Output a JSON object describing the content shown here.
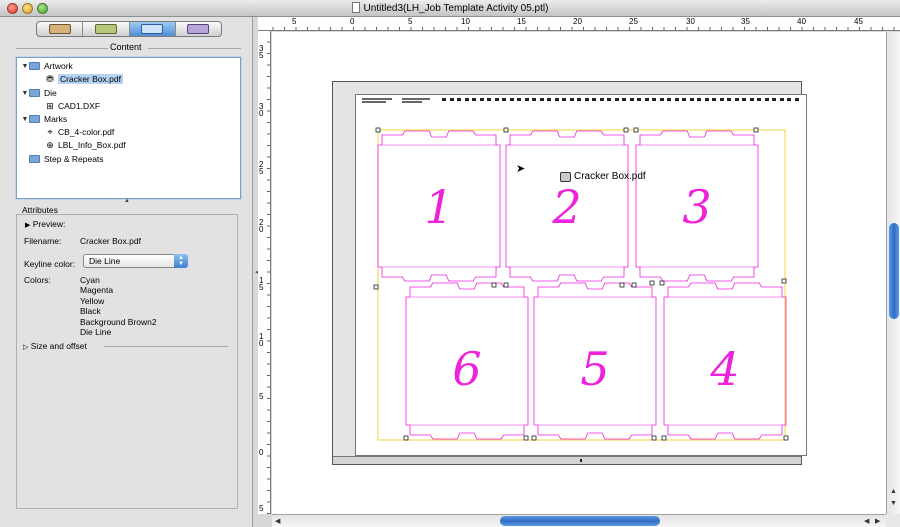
{
  "window": {
    "title": "Untitled3(LH_Job Template Activity 05.ptl)"
  },
  "left_panel": {
    "tabs": [
      {
        "name": "artwork-tab",
        "active": false
      },
      {
        "name": "die-tab",
        "active": false
      },
      {
        "name": "content-tab",
        "active": true
      },
      {
        "name": "press-tab",
        "active": false
      }
    ],
    "content": {
      "title": "Content",
      "tree": [
        {
          "label": "Artwork",
          "kind": "folder",
          "expanded": true
        },
        {
          "label": "Cracker Box.pdf",
          "kind": "file",
          "selected": true
        },
        {
          "label": "Die",
          "kind": "folder",
          "expanded": true
        },
        {
          "label": "CAD1.DXF",
          "kind": "file"
        },
        {
          "label": "Marks",
          "kind": "folder",
          "expanded": true
        },
        {
          "label": "CB_4-color.pdf",
          "kind": "file"
        },
        {
          "label": "LBL_Info_Box.pdf",
          "kind": "file"
        },
        {
          "label": "Step & Repeats",
          "kind": "folder"
        }
      ]
    },
    "attributes": {
      "title": "Attributes",
      "preview_label": "Preview:",
      "filename_label": "Filename:",
      "filename_value": "Cracker Box.pdf",
      "keyline_label": "Keyline color:",
      "keyline_value": "Die Line",
      "colors_label": "Colors:",
      "colors": [
        "Cyan",
        "Magenta",
        "Yellow",
        "Black",
        "Background Brown2",
        "Die Line"
      ],
      "size_offset_label": "Size and offset"
    }
  },
  "rulers": {
    "top_labels": [
      "5",
      "0",
      "5",
      "10",
      "15",
      "20",
      "25",
      "30",
      "35",
      "40",
      "45"
    ],
    "left_labels": [
      "3 5",
      "3 0",
      "2 5",
      "2 0",
      "1 5",
      "1 0",
      "5",
      "0",
      "5"
    ]
  },
  "canvas": {
    "drag_label": "Cracker Box.pdf",
    "box_numbers": [
      "1",
      "2",
      "3",
      "6",
      "5",
      "4"
    ],
    "die_color": "#ee22dd",
    "trim_color": "#f2d43c"
  }
}
